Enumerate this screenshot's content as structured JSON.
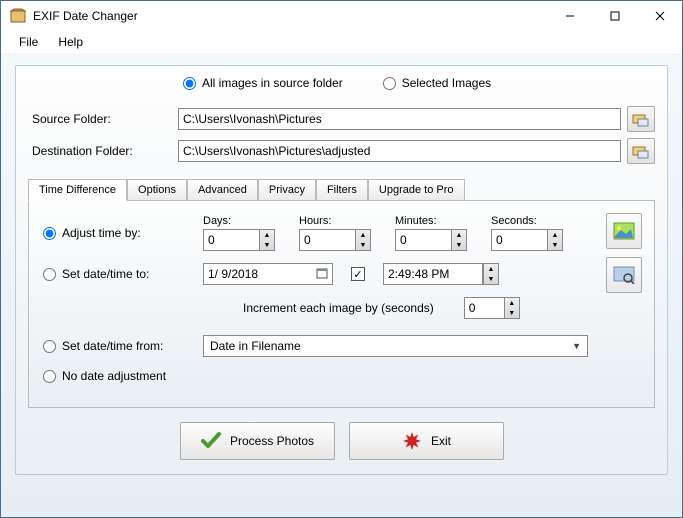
{
  "window": {
    "title": "EXIF Date Changer"
  },
  "menu": {
    "file": "File",
    "help": "Help"
  },
  "topRadios": {
    "all": "All images in source folder",
    "selected": "Selected Images"
  },
  "fields": {
    "sourceLabel": "Source Folder:",
    "sourceValue": "C:\\Users\\Ivonash\\Pictures",
    "destLabel": "Destination Folder:",
    "destValue": "C:\\Users\\Ivonash\\Pictures\\adjusted"
  },
  "tabs": {
    "timeDiff": "Time Difference",
    "options": "Options",
    "advanced": "Advanced",
    "privacy": "Privacy",
    "filters": "Filters",
    "upgrade": "Upgrade to Pro"
  },
  "adjust": {
    "label": "Adjust time by:",
    "daysLabel": "Days:",
    "daysValue": "0",
    "hoursLabel": "Hours:",
    "hoursValue": "0",
    "minutesLabel": "Minutes:",
    "minutesValue": "0",
    "secondsLabel": "Seconds:",
    "secondsValue": "0"
  },
  "setDate": {
    "label": "Set date/time to:",
    "dateValue": "1/ 9/2018",
    "timeValue": "2:49:48 PM"
  },
  "increment": {
    "label": "Increment each image by (seconds)",
    "value": "0"
  },
  "setFrom": {
    "label": "Set date/time from:",
    "value": "Date in Filename"
  },
  "noAdjust": {
    "label": "No date adjustment"
  },
  "buttons": {
    "process": "Process Photos",
    "exit": "Exit"
  }
}
